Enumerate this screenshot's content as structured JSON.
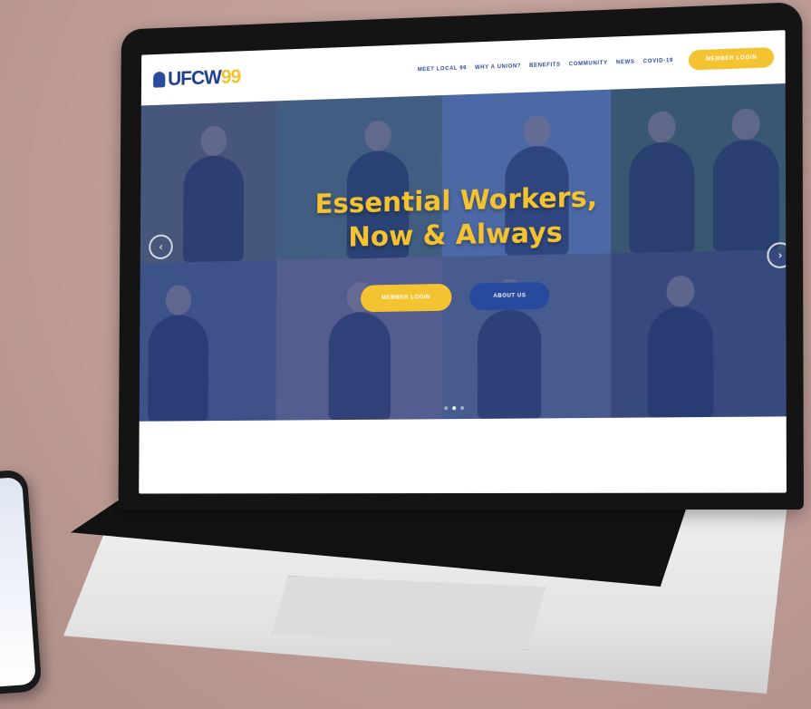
{
  "brand": {
    "logo_main": "UFCW",
    "logo_num": "99"
  },
  "nav": {
    "items": [
      "MEET LOCAL 99",
      "WHY A UNION?",
      "BENEFITS",
      "COMMUNITY",
      "NEWS",
      "COVID-19"
    ],
    "cta_label": "MEMBER LOGIN"
  },
  "hero": {
    "title_line1": "Essential Workers,",
    "title_line2": "Now & Always",
    "btn_login": "MEMBER LOGIN",
    "btn_about": "ABOUT US",
    "slider_dots": 3,
    "active_dot": 1
  },
  "icons": {
    "prev": "chevron-left-icon",
    "next": "chevron-right-icon",
    "logo": "union-logo-icon"
  },
  "colors": {
    "brand_blue": "#1e3f8f",
    "brand_yellow": "#f4c332",
    "hero_overlay": "#2f4f8f"
  }
}
